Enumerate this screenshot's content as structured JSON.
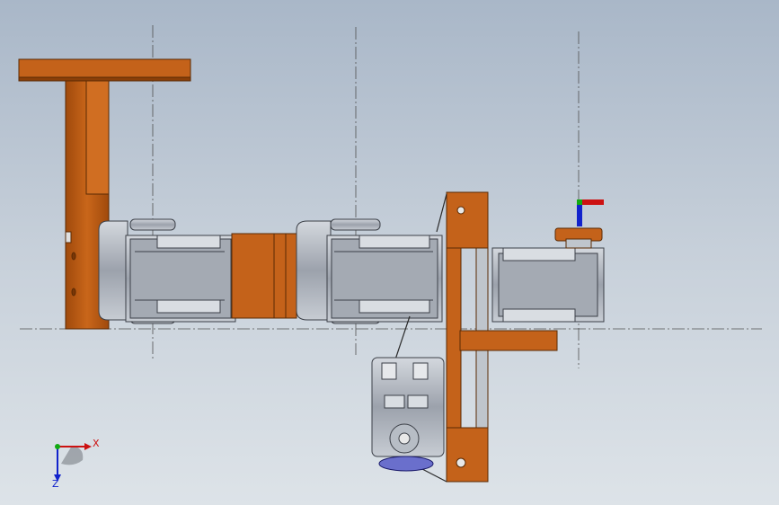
{
  "viewport": {
    "part_color": "#bf5a10",
    "part_color_dark": "#8a3f08",
    "servo_color": "#9aa0aa",
    "servo_dark": "#5c626c",
    "centerline_color": "#4a4a4a"
  },
  "triad": {
    "x_label": "X",
    "z_label": "Z",
    "x_color": "#cc1111",
    "y_color": "#11aa11",
    "z_color": "#1122cc"
  }
}
